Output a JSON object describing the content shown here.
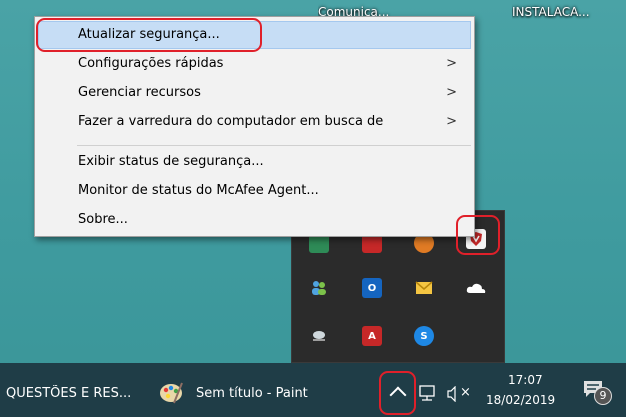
{
  "desktop": {
    "icon_label_1": "Comunica...",
    "icon_label_2": "INSTALACA..."
  },
  "context_menu": {
    "items": [
      {
        "label": "Atualizar segurança...",
        "has_submenu": false
      },
      {
        "label": "Configurações rápidas",
        "has_submenu": true
      },
      {
        "label": "Gerenciar recursos",
        "has_submenu": true
      },
      {
        "label": "Fazer a varredura do computador em busca de",
        "has_submenu": true
      },
      {
        "label": "Exibir status de segurança...",
        "has_submenu": false
      },
      {
        "label": "Monitor de status do McAfee Agent...",
        "has_submenu": false
      },
      {
        "label": "Sobre...",
        "has_submenu": false
      }
    ],
    "submenu_arrow": ">"
  },
  "tray_overflow": {
    "icons": [
      "network-app-icon",
      "mcafee-x-icon",
      "orange-app-icon",
      "mcafee-shield-icon",
      "people-icon",
      "outlook-icon",
      "mail-icon",
      "onedrive-icon",
      "usb-eject-icon",
      "adobe-icon",
      "skype-icon"
    ],
    "outlook_badge": "O",
    "adobe_badge": "A",
    "skype_badge": "S"
  },
  "taskbar": {
    "item_1_label": "QUESTÕES E RES...",
    "item_2_label": "Sem título - Paint",
    "show_hidden_caret": "^",
    "volume_mute_mark": "×",
    "time": "17:07",
    "date": "18/02/2019",
    "notification_count": "9"
  },
  "colors": {
    "desktop": "#4aa3a6",
    "taskbar": "#1f3d47",
    "menu_bg": "#f2f2f2",
    "highlight": "#c6ddf5",
    "annotation_red": "#e0202a"
  }
}
